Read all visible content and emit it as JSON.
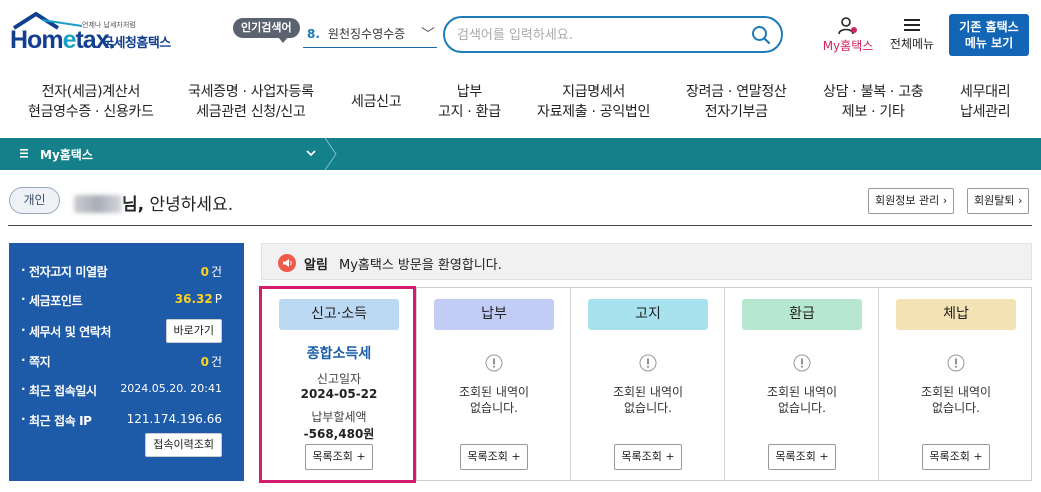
{
  "header": {
    "logo_tagline": "언제나 납세자처럼",
    "logo_wordmark_a": "Hom",
    "logo_wordmark_e": "e",
    "logo_wordmark_b": "tax.",
    "logo_korean": "국세청홈택스",
    "popular_label": "인기검색어",
    "popular_rank": "8.",
    "popular_term": "원천징수영수증",
    "search_placeholder": "검색어를 입력하세요.",
    "my_hometax": "My홈택스",
    "all_menu": "전체메뉴",
    "legacy_line1": "기존 홈택스",
    "legacy_line2": "메뉴 보기"
  },
  "gnb": [
    {
      "l1": "전자(세금)계산서",
      "l2": "현금영수증 · 신용카드"
    },
    {
      "l1": "국세증명 · 사업자등록",
      "l2": "세금관련 신청/신고"
    },
    {
      "l1": "세금신고",
      "l2": ""
    },
    {
      "l1": "납부",
      "l2": "고지 · 환급"
    },
    {
      "l1": "지급명세서",
      "l2": "자료제출 · 공익법인"
    },
    {
      "l1": "장려금 · 연말정산",
      "l2": "전자기부금"
    },
    {
      "l1": "상담 · 불복 · 고충",
      "l2": "제보 · 기타"
    },
    {
      "l1": "세무대리",
      "l2": "납세관리"
    }
  ],
  "breadcrumb": {
    "label": "My홈택스"
  },
  "greeting": {
    "badge": "개인",
    "nim": "님,",
    "text": " 안녕하세요.",
    "member_info_btn": "회원정보 관리",
    "withdraw_btn": "회원탈퇴"
  },
  "info": {
    "electronic_notice_label": "전자고지 미열람",
    "electronic_notice_value": "0",
    "electronic_notice_unit": "건",
    "tax_point_label": "세금포인트",
    "tax_point_value": "36.32",
    "tax_point_unit": "P",
    "office_label": "세무서 및 연락처",
    "office_btn": "바로가기",
    "message_label": "쪽지",
    "message_value": "0",
    "message_unit": "건",
    "last_login_label": "최근 접속일시",
    "last_login_value": "2024.05.20.  20:41",
    "last_ip_label": "최근 접속 IP",
    "last_ip_value": "121.174.196.66",
    "history_btn": "접속이력조회"
  },
  "notice": {
    "tag": "알림",
    "message": "My홈택스 방문을 환영합니다."
  },
  "cards": [
    {
      "label": "신고·소득",
      "color": "#bcd9f3",
      "title": "종합소득세",
      "cap1": "신고일자",
      "val1": "2024-05-22",
      "cap2": "납부할세액",
      "val2": "-568,480원",
      "button": "목록조회 +"
    },
    {
      "label": "납부",
      "color": "#c2ccf4",
      "empty1": "조회된 내역이",
      "empty2": "없습니다.",
      "button": "목록조회 +"
    },
    {
      "label": "고지",
      "color": "#a8e2ee",
      "empty1": "조회된 내역이",
      "empty2": "없습니다.",
      "button": "목록조회 +"
    },
    {
      "label": "환급",
      "color": "#b7e8cf",
      "empty1": "조회된 내역이",
      "empty2": "없습니다.",
      "button": "목록조회 +"
    },
    {
      "label": "체납",
      "color": "#f3e2b4",
      "empty1": "조회된 내역이",
      "empty2": "없습니다.",
      "button": "목록조회 +"
    }
  ],
  "colors": {
    "brand": "#123f8f",
    "teal": "#13808a",
    "panel": "#1d5aa8",
    "highlight": "#d41c6d",
    "accent_yellow": "#ffd21f"
  }
}
